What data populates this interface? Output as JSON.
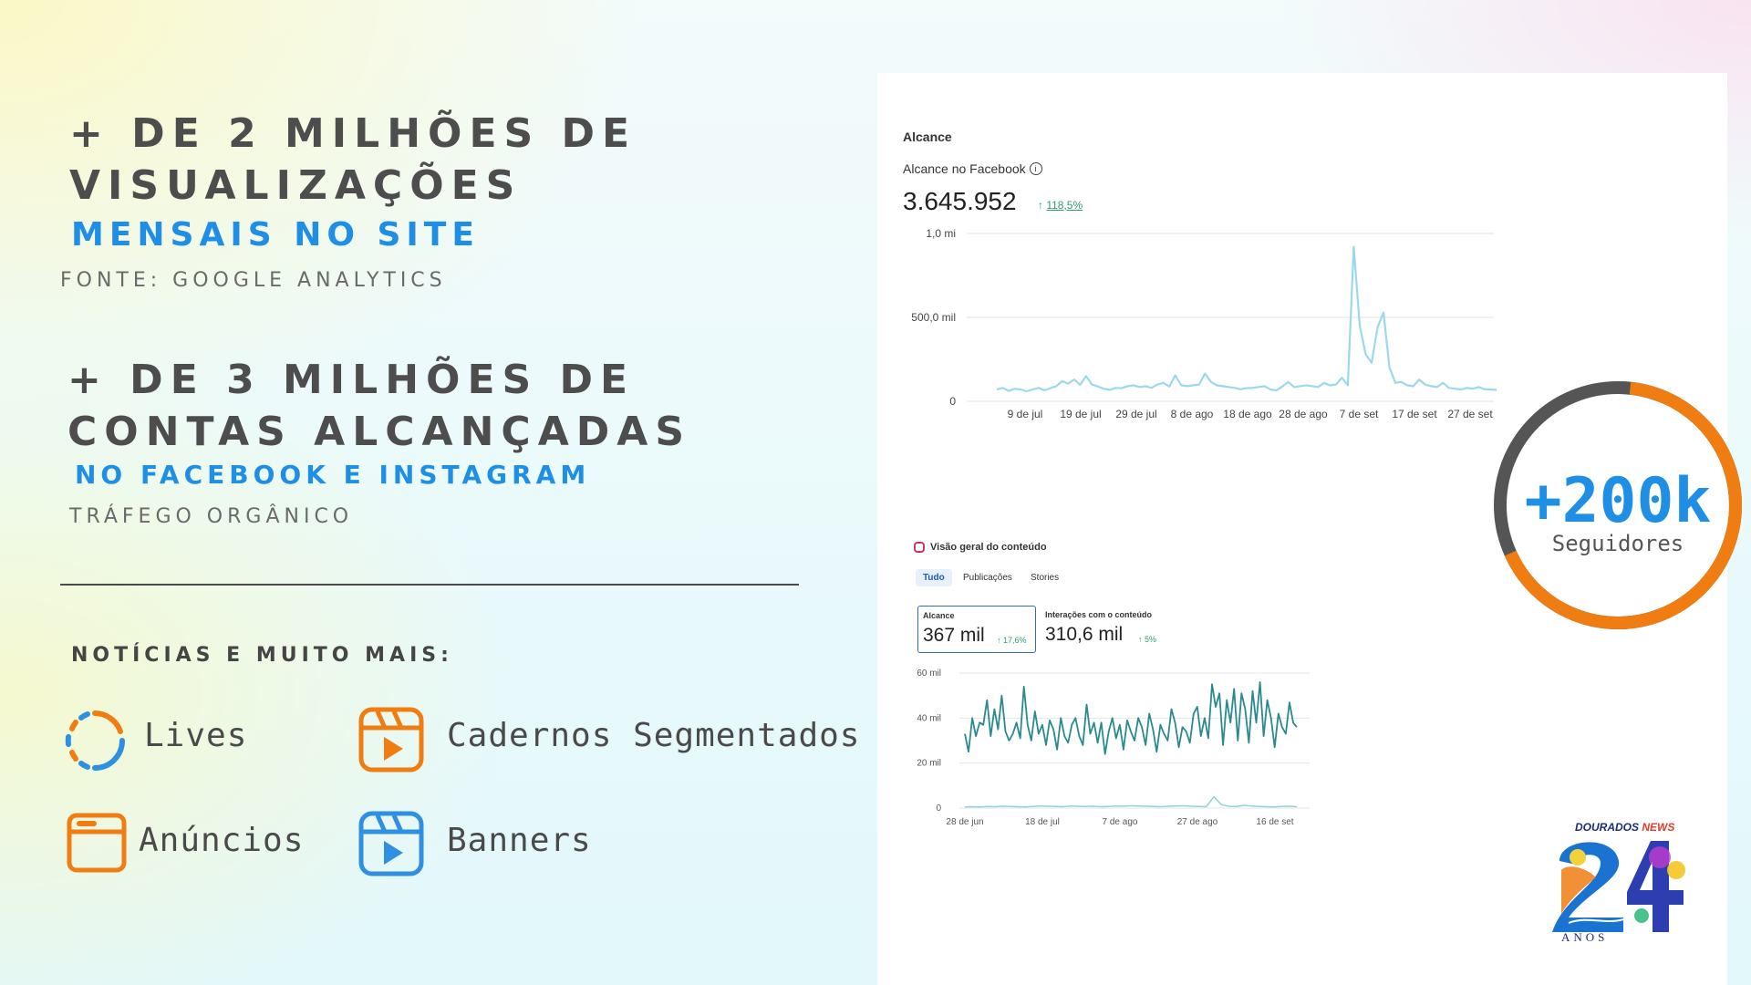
{
  "left": {
    "block1": {
      "line1": "+ DE 2 MILHÕES DE",
      "line2": "VISUALIZAÇÕES",
      "highlight": "MENSAIS NO SITE",
      "source": "FONTE: GOOGLE ANALYTICS"
    },
    "block2": {
      "line1": "+ DE 3 MILHÕES DE",
      "line2": "CONTAS ALCANÇADAS",
      "highlight": "NO FACEBOOK E INSTAGRAM",
      "source": "TRÁFEGO ORGÂNICO"
    },
    "subtitle": "NOTÍCIAS E MUITO MAIS:",
    "features": [
      {
        "label": "Lives",
        "icon": "live-ring-icon"
      },
      {
        "label": "Cadernos Segmentados",
        "icon": "video-clapper-icon"
      },
      {
        "label": "Anúncios",
        "icon": "browser-window-icon"
      },
      {
        "label": "Banners",
        "icon": "video-clapper-icon"
      }
    ]
  },
  "facebook": {
    "section": "Alcance",
    "label": "Alcance no Facebook",
    "value": "3.645.952",
    "change": "118,5%",
    "change_color": "#2e9e6a",
    "line_color": "#9bd8ee"
  },
  "instagram": {
    "title": "Visão geral do conteúdo",
    "tabs": [
      "Tudo",
      "Publicações",
      "Stories"
    ],
    "metrics": [
      {
        "label": "Alcance",
        "value": "367 mil",
        "change": "17,6%"
      },
      {
        "label": "Interações com o conteúdo",
        "value": "310,6 mil",
        "change": "5%"
      }
    ],
    "line_color": "#2a8a8f",
    "baseline_color": "#8fd3de"
  },
  "followers": {
    "number": "+200k",
    "label": "Seguidores",
    "ring_orange": "#f07d12",
    "ring_gray": "#555555"
  },
  "logo": {
    "brand_a": "DOURADOS",
    "brand_b": "NEWS",
    "years": "ANOS"
  },
  "chart_data": [
    {
      "type": "line",
      "title": "Alcance no Facebook",
      "x_tick_labels": [
        "9 de jul",
        "19 de jul",
        "29 de jul",
        "8 de ago",
        "18 de ago",
        "28 de ago",
        "7 de set",
        "17 de set",
        "27 de set"
      ],
      "y_tick_labels": [
        "0",
        "500,0 mil",
        "1,0 mi"
      ],
      "ylim": [
        0,
        1000000
      ],
      "grid": true,
      "series": [
        {
          "values": [
            70000,
            80000,
            62000,
            75000,
            70000,
            60000,
            70000,
            80000,
            65000,
            78000,
            90000,
            120000,
            105000,
            130000,
            98000,
            150000,
            100000,
            88000,
            75000,
            68000,
            80000,
            78000,
            90000,
            95000,
            85000,
            90000,
            80000,
            100000,
            110000,
            88000,
            155000,
            95000,
            90000,
            95000,
            100000,
            165000,
            115000,
            95000,
            90000,
            85000,
            80000,
            72000,
            78000,
            80000,
            85000,
            90000,
            70000,
            65000,
            88000,
            115000,
            85000,
            90000,
            95000,
            90000,
            85000,
            110000,
            95000,
            100000,
            140000,
            95000,
            920000,
            450000,
            280000,
            230000,
            440000,
            530000,
            200000,
            110000,
            115000,
            95000,
            90000,
            130000,
            100000,
            90000,
            85000,
            110000,
            80000,
            75000,
            70000,
            80000,
            75000,
            85000,
            72000,
            70000,
            68000
          ]
        }
      ]
    },
    {
      "type": "line",
      "title": "Visão geral do conteúdo",
      "x_tick_labels": [
        "28 de jun",
        "18 de jul",
        "7 de ago",
        "27 de ago",
        "16 de set"
      ],
      "y_tick_labels": [
        "0",
        "20 mil",
        "40 mil",
        "60 mil"
      ],
      "ylim": [
        0,
        60000
      ],
      "grid": true,
      "series": [
        {
          "values": [
            33000,
            25000,
            40000,
            32000,
            38000,
            37000,
            48000,
            32000,
            44000,
            35000,
            50000,
            34000,
            30000,
            33000,
            38000,
            31000,
            54000,
            37000,
            30000,
            43000,
            33000,
            37000,
            28000,
            39000,
            35000,
            26000,
            40000,
            32000,
            29000,
            37000,
            40000,
            32000,
            28000,
            46000,
            33000,
            38000,
            29000,
            38000,
            24000,
            34000,
            40000,
            31000,
            37000,
            26000,
            39000,
            34000,
            30000,
            40000,
            36000,
            28000,
            42000,
            35000,
            25000,
            37000,
            33000,
            30000,
            44000,
            38000,
            27000,
            36000,
            34000,
            29000,
            42000,
            45000,
            32000,
            40000,
            31000,
            55000,
            45000,
            51000,
            28000,
            48000,
            38000,
            53000,
            30000,
            51000,
            44000,
            29000,
            52000,
            38000,
            56000,
            32000,
            48000,
            40000,
            27000,
            42000,
            36000,
            33000,
            47000,
            38000,
            36000
          ]
        },
        {
          "values": [
            500,
            600,
            500,
            700,
            600,
            800,
            700,
            600,
            500,
            700,
            900,
            800,
            700,
            600,
            900,
            800,
            700,
            800,
            600,
            700,
            900,
            800,
            1000,
            900,
            800,
            700,
            600,
            800,
            900,
            1000,
            800,
            700,
            600,
            5000,
            1500,
            800,
            700,
            1200,
            900,
            700,
            600,
            500,
            700,
            800,
            600
          ]
        }
      ]
    }
  ]
}
